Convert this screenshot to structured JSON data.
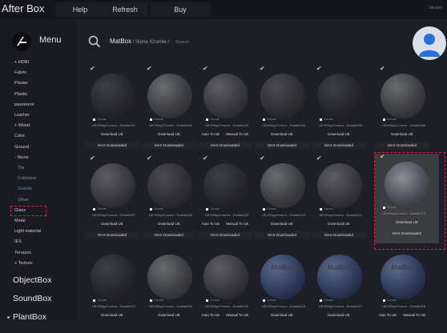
{
  "app": {
    "title": "After Box",
    "version": "Version"
  },
  "topbar": {
    "help": "Help",
    "refresh": "Refresh",
    "buy": "Buy"
  },
  "sidebar": {
    "menu_label": "Menu",
    "categories": [
      {
        "label": "+ HDRI"
      },
      {
        "label": "Fabric"
      },
      {
        "label": "Plaster"
      },
      {
        "label": "Plastic"
      },
      {
        "label": "pavement"
      },
      {
        "label": "Leather"
      },
      {
        "label": "+ Wood"
      },
      {
        "label": "Color"
      },
      {
        "label": "Ground"
      },
      {
        "label": "- Stone"
      },
      {
        "label": "Tile",
        "sub": true
      },
      {
        "label": "Cultstone",
        "sub": true
      },
      {
        "label": "Granite",
        "sub": true,
        "active": true
      },
      {
        "label": "Other",
        "sub": true
      },
      {
        "label": "Glass"
      },
      {
        "label": "Metal"
      },
      {
        "label": "Light material"
      },
      {
        "label": "IES"
      },
      {
        "label": "Terrazzo"
      },
      {
        "label": "+ Texture"
      }
    ],
    "sections": [
      "ObjectBox",
      "SoundBox",
      "PlantBox"
    ]
  },
  "search": {
    "root": "MatBox",
    "path": " / Stone /Granite / ",
    "placeholder": "Search"
  },
  "labels": {
    "engine": "Corona",
    "download_ue": "Download UE",
    "max_downloaded": "MAX Downloaded",
    "auto_to_ue": "Auto To UE",
    "manual_to_ue": "Manual To UE",
    "matbox": "MatBox"
  },
  "materials": [
    {
      "name": "UE/VRay/Corona - Granite001",
      "downloaded": true,
      "ue": "Download UE"
    },
    {
      "name": "UE/VRay/Corona - Granite002",
      "downloaded": true,
      "ue": "Download UE"
    },
    {
      "name": "UE/VRay/Corona - Granite003",
      "downloaded": true,
      "ue": "auto_manual"
    },
    {
      "name": "UE/VRay/Corona - Granite004",
      "downloaded": true,
      "ue": "Download UE"
    },
    {
      "name": "UE/VRay/Corona - Granite005",
      "downloaded": true,
      "ue": "Download UE"
    },
    {
      "name": "UE/VRay/Corona - Granite006",
      "downloaded": true,
      "ue": "Download UE"
    },
    {
      "name": "UE/VRay/Corona - Granite007",
      "downloaded": true,
      "ue": "Download UE"
    },
    {
      "name": "UE/VRay/Corona - Granite008",
      "downloaded": true,
      "ue": "Download UE"
    },
    {
      "name": "UE/VRay/Corona - Granite009",
      "downloaded": true,
      "ue": "auto_manual"
    },
    {
      "name": "UE/VRay/Corona - Granite010",
      "downloaded": true,
      "ue": "Download UE"
    },
    {
      "name": "UE/VRay/Corona - Granite011",
      "downloaded": true,
      "ue": "Download UE"
    },
    {
      "name": "UE/VRay/Corona - Granite012",
      "downloaded": true,
      "ue": "Download UE",
      "selected": true
    },
    {
      "name": "UE/VRay/Corona - Granite013",
      "downloaded": false,
      "ue": "Download UE"
    },
    {
      "name": "UE/VRay/Corona - Granite014",
      "downloaded": false,
      "ue": "Download UE"
    },
    {
      "name": "UE/VRay/Corona - Granite015",
      "downloaded": false,
      "ue": "auto_manual"
    },
    {
      "name": "UE/VRay/Corona - Granite016",
      "downloaded": false,
      "ue": "Download UE",
      "watermark": true
    },
    {
      "name": "UE/VRay/Corona - Granite017",
      "downloaded": false,
      "ue": "Download UE",
      "watermark": true
    },
    {
      "name": "UE/VRay/Corona - Granite018",
      "downloaded": false,
      "ue": "auto_manual",
      "watermark": true
    }
  ],
  "colors": {
    "accent": "#5d83d6",
    "highlight": "#d32b2b",
    "check": "#a9d39b"
  }
}
